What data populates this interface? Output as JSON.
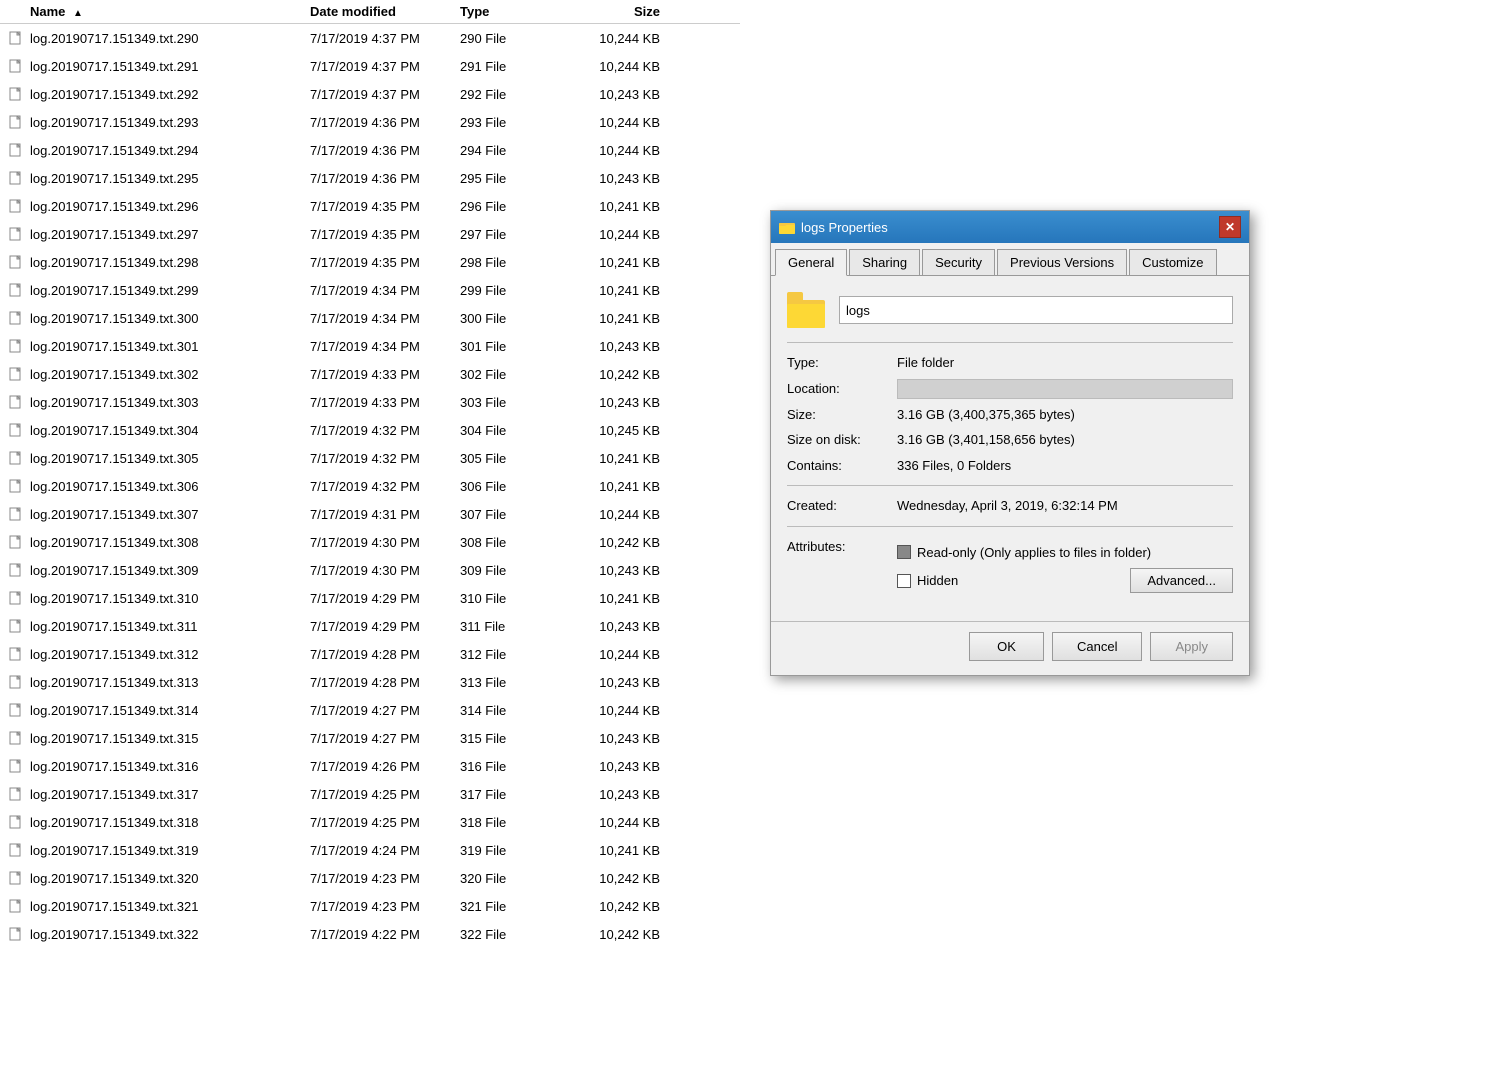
{
  "fileList": {
    "headers": {
      "name": "Name",
      "dateModified": "Date modified",
      "type": "Type",
      "size": "Size"
    },
    "files": [
      {
        "name": "log.20190717.151349.txt.290",
        "date": "7/17/2019 4:37 PM",
        "type": "290 File",
        "size": "10,244 KB"
      },
      {
        "name": "log.20190717.151349.txt.291",
        "date": "7/17/2019 4:37 PM",
        "type": "291 File",
        "size": "10,244 KB"
      },
      {
        "name": "log.20190717.151349.txt.292",
        "date": "7/17/2019 4:37 PM",
        "type": "292 File",
        "size": "10,243 KB"
      },
      {
        "name": "log.20190717.151349.txt.293",
        "date": "7/17/2019 4:36 PM",
        "type": "293 File",
        "size": "10,244 KB"
      },
      {
        "name": "log.20190717.151349.txt.294",
        "date": "7/17/2019 4:36 PM",
        "type": "294 File",
        "size": "10,244 KB"
      },
      {
        "name": "log.20190717.151349.txt.295",
        "date": "7/17/2019 4:36 PM",
        "type": "295 File",
        "size": "10,243 KB"
      },
      {
        "name": "log.20190717.151349.txt.296",
        "date": "7/17/2019 4:35 PM",
        "type": "296 File",
        "size": "10,241 KB"
      },
      {
        "name": "log.20190717.151349.txt.297",
        "date": "7/17/2019 4:35 PM",
        "type": "297 File",
        "size": "10,244 KB"
      },
      {
        "name": "log.20190717.151349.txt.298",
        "date": "7/17/2019 4:35 PM",
        "type": "298 File",
        "size": "10,241 KB"
      },
      {
        "name": "log.20190717.151349.txt.299",
        "date": "7/17/2019 4:34 PM",
        "type": "299 File",
        "size": "10,241 KB"
      },
      {
        "name": "log.20190717.151349.txt.300",
        "date": "7/17/2019 4:34 PM",
        "type": "300 File",
        "size": "10,241 KB"
      },
      {
        "name": "log.20190717.151349.txt.301",
        "date": "7/17/2019 4:34 PM",
        "type": "301 File",
        "size": "10,243 KB"
      },
      {
        "name": "log.20190717.151349.txt.302",
        "date": "7/17/2019 4:33 PM",
        "type": "302 File",
        "size": "10,242 KB"
      },
      {
        "name": "log.20190717.151349.txt.303",
        "date": "7/17/2019 4:33 PM",
        "type": "303 File",
        "size": "10,243 KB"
      },
      {
        "name": "log.20190717.151349.txt.304",
        "date": "7/17/2019 4:32 PM",
        "type": "304 File",
        "size": "10,245 KB"
      },
      {
        "name": "log.20190717.151349.txt.305",
        "date": "7/17/2019 4:32 PM",
        "type": "305 File",
        "size": "10,241 KB"
      },
      {
        "name": "log.20190717.151349.txt.306",
        "date": "7/17/2019 4:32 PM",
        "type": "306 File",
        "size": "10,241 KB"
      },
      {
        "name": "log.20190717.151349.txt.307",
        "date": "7/17/2019 4:31 PM",
        "type": "307 File",
        "size": "10,244 KB"
      },
      {
        "name": "log.20190717.151349.txt.308",
        "date": "7/17/2019 4:30 PM",
        "type": "308 File",
        "size": "10,242 KB"
      },
      {
        "name": "log.20190717.151349.txt.309",
        "date": "7/17/2019 4:30 PM",
        "type": "309 File",
        "size": "10,243 KB"
      },
      {
        "name": "log.20190717.151349.txt.310",
        "date": "7/17/2019 4:29 PM",
        "type": "310 File",
        "size": "10,241 KB"
      },
      {
        "name": "log.20190717.151349.txt.311",
        "date": "7/17/2019 4:29 PM",
        "type": "311 File",
        "size": "10,243 KB"
      },
      {
        "name": "log.20190717.151349.txt.312",
        "date": "7/17/2019 4:28 PM",
        "type": "312 File",
        "size": "10,244 KB"
      },
      {
        "name": "log.20190717.151349.txt.313",
        "date": "7/17/2019 4:28 PM",
        "type": "313 File",
        "size": "10,243 KB"
      },
      {
        "name": "log.20190717.151349.txt.314",
        "date": "7/17/2019 4:27 PM",
        "type": "314 File",
        "size": "10,244 KB"
      },
      {
        "name": "log.20190717.151349.txt.315",
        "date": "7/17/2019 4:27 PM",
        "type": "315 File",
        "size": "10,243 KB"
      },
      {
        "name": "log.20190717.151349.txt.316",
        "date": "7/17/2019 4:26 PM",
        "type": "316 File",
        "size": "10,243 KB"
      },
      {
        "name": "log.20190717.151349.txt.317",
        "date": "7/17/2019 4:25 PM",
        "type": "317 File",
        "size": "10,243 KB"
      },
      {
        "name": "log.20190717.151349.txt.318",
        "date": "7/17/2019 4:25 PM",
        "type": "318 File",
        "size": "10,244 KB"
      },
      {
        "name": "log.20190717.151349.txt.319",
        "date": "7/17/2019 4:24 PM",
        "type": "319 File",
        "size": "10,241 KB"
      },
      {
        "name": "log.20190717.151349.txt.320",
        "date": "7/17/2019 4:23 PM",
        "type": "320 File",
        "size": "10,242 KB"
      },
      {
        "name": "log.20190717.151349.txt.321",
        "date": "7/17/2019 4:23 PM",
        "type": "321 File",
        "size": "10,242 KB"
      },
      {
        "name": "log.20190717.151349.txt.322",
        "date": "7/17/2019 4:22 PM",
        "type": "322 File",
        "size": "10,242 KB"
      }
    ]
  },
  "dialog": {
    "title": "logs Properties",
    "tabs": [
      "General",
      "Sharing",
      "Security",
      "Previous Versions",
      "Customize"
    ],
    "activeTab": "General",
    "folderName": "logs",
    "properties": {
      "typeLabel": "Type:",
      "typeValue": "File folder",
      "locationLabel": "Location:",
      "sizeLabel": "Size:",
      "sizeValue": "3.16 GB (3,400,375,365 bytes)",
      "sizeOnDiskLabel": "Size on disk:",
      "sizeOnDiskValue": "3.16 GB (3,401,158,656 bytes)",
      "containsLabel": "Contains:",
      "containsValue": "336 Files, 0 Folders",
      "createdLabel": "Created:",
      "createdValue": "Wednesday, April 3, 2019, 6:32:14 PM",
      "attributesLabel": "Attributes:"
    },
    "attributes": {
      "readOnlyLabel": "Read-only (Only applies to files in folder)",
      "hiddenLabel": "Hidden",
      "advancedLabel": "Advanced..."
    },
    "buttons": {
      "ok": "OK",
      "cancel": "Cancel",
      "apply": "Apply"
    }
  }
}
